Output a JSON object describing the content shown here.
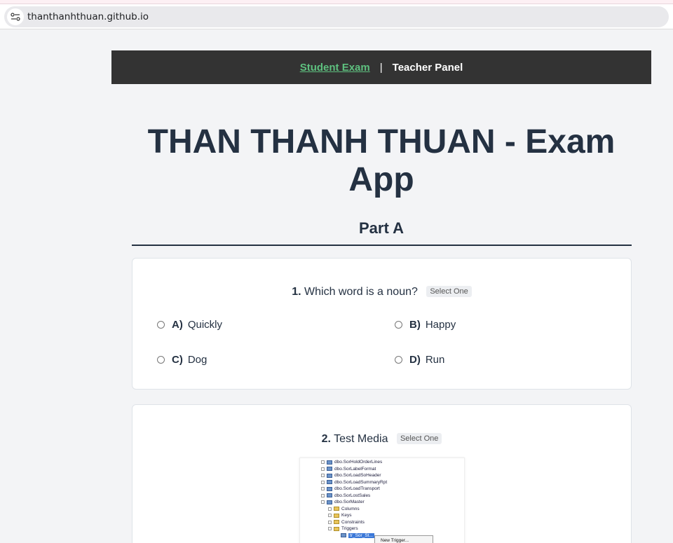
{
  "browser": {
    "url": "thanthanhthuan.github.io",
    "site_icon": "site-settings-icon"
  },
  "nav": {
    "student_exam": "Student Exam",
    "separator": "|",
    "teacher_panel": "Teacher Panel"
  },
  "page": {
    "title_line1": "THAN THANH THUAN - Exam",
    "title_line2": "App",
    "part_title": "Part A"
  },
  "questions": [
    {
      "number": "1.",
      "text": "Which word is a noun?",
      "badge": "Select One",
      "options": [
        {
          "letter": "A)",
          "text": "Quickly"
        },
        {
          "letter": "B)",
          "text": "Happy"
        },
        {
          "letter": "C)",
          "text": "Dog"
        },
        {
          "letter": "D)",
          "text": "Run"
        }
      ]
    },
    {
      "number": "2.",
      "text": "Test Media",
      "badge": "Select One",
      "media": {
        "tree": [
          "dbo.SorHoldOrderLines",
          "dbo.SorLabelFormat",
          "dbo.SorLoadSoHeader",
          "dbo.SorLoadSummaryRpt",
          "dbo.SorLoadTransport",
          "dbo.SorLostSales",
          "dbo.SorMaster",
          "Columns",
          "Keys",
          "Constraints",
          "Triggers",
          "tr_Sor_St..."
        ],
        "context_menu": "New Trigger..."
      }
    }
  ],
  "colors": {
    "nav_bg": "#333333",
    "nav_active": "#5ec07f",
    "text": "#243142",
    "page_bg": "#f3f4f6"
  }
}
